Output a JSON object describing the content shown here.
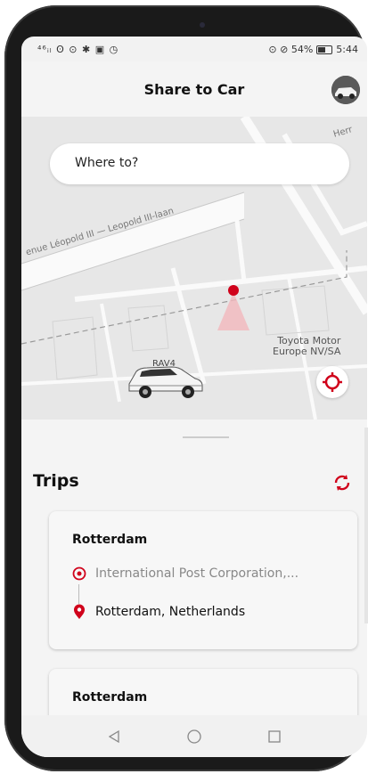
{
  "status_bar": {
    "left_icons": "⁴⁶ᵢₗ ʘ ⊙ ✱ ▣ ◷",
    "right_text": "⊙ ⊘ 54%",
    "time": "5:44"
  },
  "header": {
    "title": "Share to Car"
  },
  "map": {
    "search_placeholder": "Where to?",
    "street_label": "enue Léopold III — Leopold III-laan",
    "street_label_2": "Herr",
    "poi_label_line1": "Toyota Motor",
    "poi_label_line2": "Europe NV/SA",
    "car_label": "RAV4",
    "accent_color": "#d0021b"
  },
  "trips": {
    "title": "Trips",
    "cards": [
      {
        "title": "Rotterdam",
        "origin": "International Post Corporation,...",
        "destination": "Rotterdam, Netherlands"
      },
      {
        "title": "Rotterdam"
      }
    ]
  },
  "nav": {
    "back_icon": "back-triangle",
    "home_icon": "home-circle",
    "recents_icon": "recents-square"
  }
}
